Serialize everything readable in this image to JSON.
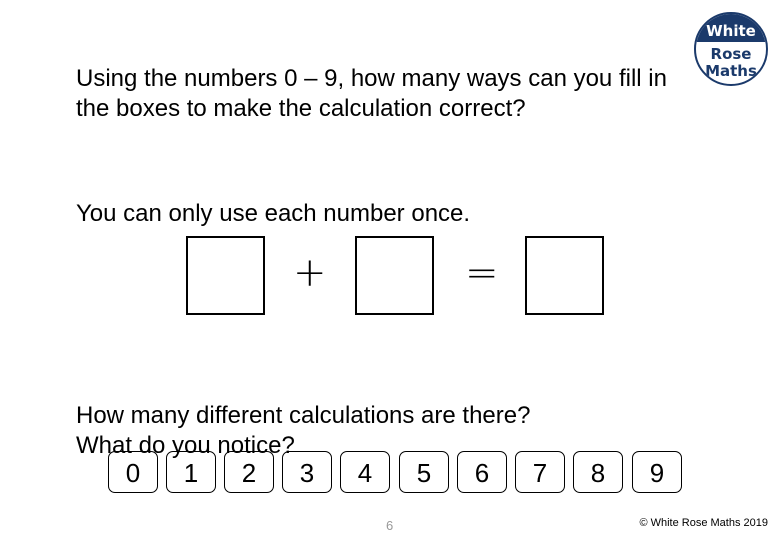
{
  "logo": {
    "line1": "White",
    "line2": "Rose",
    "line3": "Maths",
    "brand_color": "#1b3a6b"
  },
  "question": {
    "intro": "Using the numbers 0 – 9, how many ways can you fill in the boxes to make the calculation correct?",
    "rule": "You can only use each number once.",
    "followup_line1": "How many different calculations are there?",
    "followup_line2": "What do you notice?"
  },
  "equation": {
    "operator_plus": "+",
    "operator_equals": "=",
    "boxes": [
      "",
      "",
      ""
    ]
  },
  "number_tiles": [
    "0",
    "1",
    "2",
    "3",
    "4",
    "5",
    "6",
    "7",
    "8",
    "9"
  ],
  "footer": {
    "page_number": "6",
    "copyright": "© White Rose Maths 2019"
  }
}
